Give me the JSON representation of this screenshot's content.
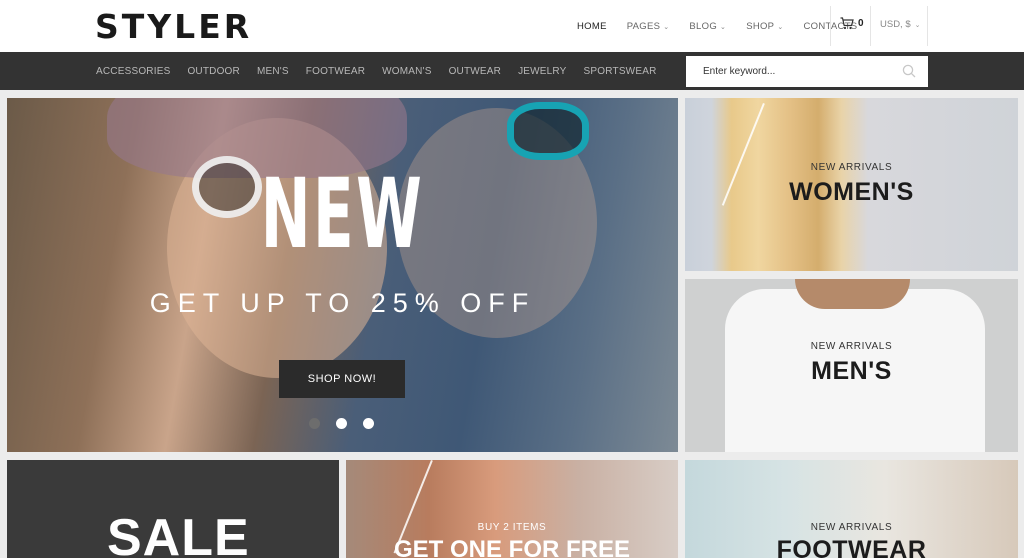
{
  "header": {
    "logo": "STYLER",
    "nav": [
      {
        "label": "HOME",
        "dropdown": false
      },
      {
        "label": "PAGES",
        "dropdown": true
      },
      {
        "label": "BLOG",
        "dropdown": true
      },
      {
        "label": "SHOP",
        "dropdown": true
      },
      {
        "label": "CONTACTS",
        "dropdown": false
      }
    ],
    "cart_count": "0",
    "currency": "USD, $"
  },
  "categories": [
    "ACCESSORIES",
    "OUTDOOR",
    "MEN'S",
    "FOOTWEAR",
    "WOMAN'S",
    "OUTWEAR",
    "JEWELRY",
    "SPORTSWEAR"
  ],
  "search": {
    "placeholder": "Enter keyword..."
  },
  "hero": {
    "title": "NEW",
    "subtitle": "GET UP TO 25% OFF",
    "button": "SHOP NOW!",
    "slides_total": 3,
    "active_slide": 2
  },
  "tiles": {
    "women": {
      "small": "NEW ARRIVALS",
      "big": "WOMEN'S"
    },
    "men": {
      "small": "NEW ARRIVALS",
      "big": "MEN'S"
    },
    "footwear": {
      "small": "NEW ARRIVALS",
      "big": "FOOTWEAR"
    },
    "sale": {
      "big": "SALE"
    },
    "buy": {
      "small": "BUY 2 ITEMS",
      "big": "GET ONE FOR FREE"
    }
  },
  "colors": {
    "topbar": "#ffffff",
    "catbar": "#333333",
    "button": "#2b2b2b",
    "text_dark": "#1c1c1c"
  },
  "icons": {
    "cart": "cart-icon",
    "search": "search-icon",
    "caret": "chevron-down-icon"
  }
}
